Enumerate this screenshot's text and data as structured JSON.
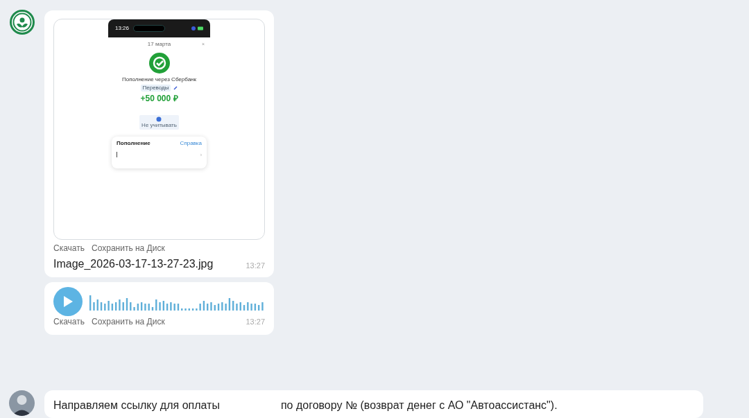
{
  "messages": [
    {
      "kind": "image",
      "phone_screenshot": {
        "status_time": "13:26",
        "date": "17 марта",
        "close": "×",
        "title": "Пополнение через Сбербанк",
        "tag": "Переводы",
        "amount": "+50 000 ₽",
        "action": "Не учитывать",
        "card_title": "Пополнение",
        "card_link": "Справка",
        "card_arrow": "›"
      },
      "actions": [
        "Скачать",
        "Сохранить на Диск"
      ],
      "file_name": "Image_2026-03-17-13-27-23.jpg",
      "time": "13:27"
    },
    {
      "kind": "voice",
      "actions": [
        "Скачать",
        "Сохранить на Диск"
      ],
      "time": "13:27"
    },
    {
      "kind": "text",
      "text_before": "Направляем ссылку для оплаты",
      "text_after": "по договору № (возврат денег с АО \"Автоассистанс\")."
    }
  ]
}
